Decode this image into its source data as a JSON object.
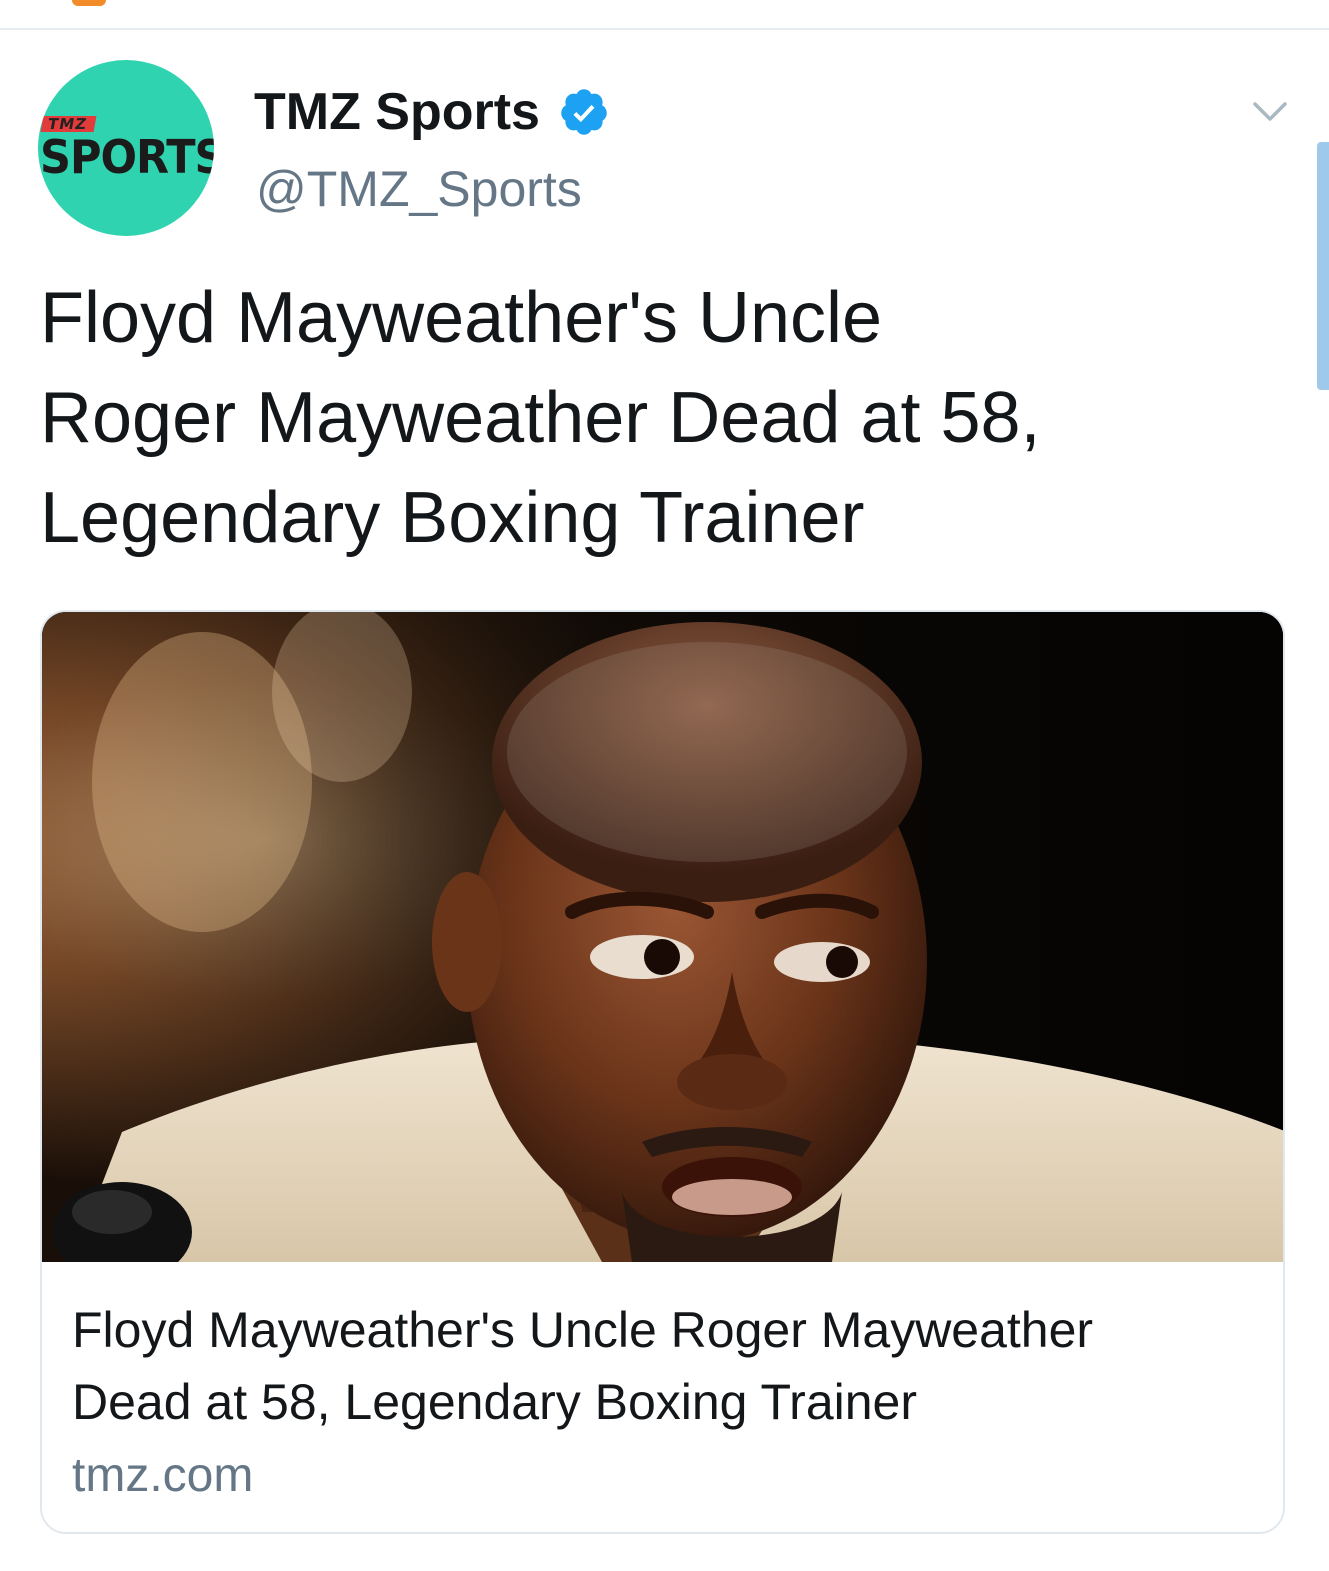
{
  "account": {
    "display_name": "TMZ Sports",
    "handle": "@TMZ_Sports",
    "verified": true,
    "avatar": {
      "small_label": "TMZ",
      "label": "SPORTS",
      "background": "#2fd3b0"
    }
  },
  "tweet": {
    "text_lines": [
      "Floyd Mayweather's Uncle",
      "Roger Mayweather Dead at 58,",
      "Legendary Boxing Trainer"
    ]
  },
  "card": {
    "image_icon": "photo-of-man-in-cream-jacket",
    "title_lines": [
      "Floyd Mayweather's Uncle Roger Mayweather",
      "Dead at 58, Legendary Boxing Trainer"
    ],
    "domain": "tmz.com"
  },
  "icons": {
    "verified": "verified-badge-icon",
    "caret": "chevron-down-icon"
  },
  "colors": {
    "verified_blue": "#1da1f2",
    "text": "#14171a",
    "secondary_text": "#657786",
    "card_border": "#e1e8ed"
  }
}
